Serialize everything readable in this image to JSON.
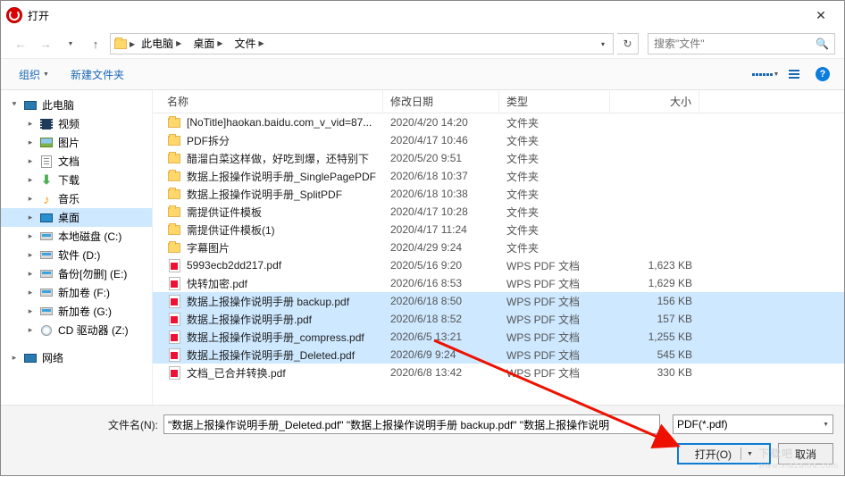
{
  "window": {
    "title": "打开"
  },
  "breadcrumb": {
    "segs": [
      "此电脑",
      "桌面",
      "文件"
    ]
  },
  "search": {
    "placeholder": "搜索\"文件\""
  },
  "toolbar": {
    "organize": "组织",
    "newfolder": "新建文件夹"
  },
  "sidebar": {
    "thispc": "此电脑",
    "items": [
      {
        "label": "视频",
        "icon": "video"
      },
      {
        "label": "图片",
        "icon": "picture"
      },
      {
        "label": "文档",
        "icon": "document"
      },
      {
        "label": "下载",
        "icon": "download"
      },
      {
        "label": "音乐",
        "icon": "music"
      },
      {
        "label": "桌面",
        "icon": "desktop",
        "selected": true
      },
      {
        "label": "本地磁盘 (C:)",
        "icon": "drive"
      },
      {
        "label": "软件 (D:)",
        "icon": "drive"
      },
      {
        "label": "备份[勿删] (E:)",
        "icon": "drive"
      },
      {
        "label": "新加卷 (F:)",
        "icon": "drive"
      },
      {
        "label": "新加卷 (G:)",
        "icon": "drive"
      },
      {
        "label": "CD 驱动器 (Z:)",
        "icon": "cd"
      }
    ],
    "network": "网络"
  },
  "headers": {
    "name": "名称",
    "date": "修改日期",
    "type": "类型",
    "size": "大小"
  },
  "files": [
    {
      "name": "[NoTitle]haokan.baidu.com_v_vid=87...",
      "date": "2020/4/20 14:20",
      "type": "文件夹",
      "size": "",
      "icon": "folder"
    },
    {
      "name": "PDF拆分",
      "date": "2020/4/17 10:46",
      "type": "文件夹",
      "size": "",
      "icon": "folder"
    },
    {
      "name": "醋溜白菜这样做，好吃到爆，还特别下",
      "date": "2020/5/20 9:51",
      "type": "文件夹",
      "size": "",
      "icon": "folder"
    },
    {
      "name": "数据上报操作说明手册_SinglePagePDF",
      "date": "2020/6/18 10:37",
      "type": "文件夹",
      "size": "",
      "icon": "folder"
    },
    {
      "name": "数据上报操作说明手册_SplitPDF",
      "date": "2020/6/18 10:38",
      "type": "文件夹",
      "size": "",
      "icon": "folder"
    },
    {
      "name": "需提供证件模板",
      "date": "2020/4/17 10:28",
      "type": "文件夹",
      "size": "",
      "icon": "folder"
    },
    {
      "name": "需提供证件模板(1)",
      "date": "2020/4/17 11:24",
      "type": "文件夹",
      "size": "",
      "icon": "folder"
    },
    {
      "name": "字幕图片",
      "date": "2020/4/29 9:24",
      "type": "文件夹",
      "size": "",
      "icon": "folder"
    },
    {
      "name": "5993ecb2dd217.pdf",
      "date": "2020/5/16 9:20",
      "type": "WPS PDF 文档",
      "size": "1,623 KB",
      "icon": "pdf"
    },
    {
      "name": "快转加密.pdf",
      "date": "2020/6/16 8:53",
      "type": "WPS PDF 文档",
      "size": "1,629 KB",
      "icon": "pdf"
    },
    {
      "name": "数据上报操作说明手册 backup.pdf",
      "date": "2020/6/18 8:50",
      "type": "WPS PDF 文档",
      "size": "156 KB",
      "icon": "pdf",
      "sel": true
    },
    {
      "name": "数据上报操作说明手册.pdf",
      "date": "2020/6/18 8:52",
      "type": "WPS PDF 文档",
      "size": "157 KB",
      "icon": "pdf",
      "sel": true
    },
    {
      "name": "数据上报操作说明手册_compress.pdf",
      "date": "2020/6/5 13:21",
      "type": "WPS PDF 文档",
      "size": "1,255 KB",
      "icon": "pdf",
      "sel": true
    },
    {
      "name": "数据上报操作说明手册_Deleted.pdf",
      "date": "2020/6/9 9:24",
      "type": "WPS PDF 文档",
      "size": "545 KB",
      "icon": "pdf",
      "sel": true
    },
    {
      "name": "文档_已合并转换.pdf",
      "date": "2020/6/8 13:42",
      "type": "WPS PDF 文档",
      "size": "330 KB",
      "icon": "pdf"
    }
  ],
  "footer": {
    "filename_label": "文件名(N):",
    "filename_value": "\"数据上报操作说明手册_Deleted.pdf\" \"数据上报操作说明手册 backup.pdf\" \"数据上报操作说明",
    "filetype": "PDF(*.pdf)",
    "open": "打开(O)",
    "cancel": "取消"
  },
  "watermark": {
    "main": "下载吧",
    "sub": "www.xiazaiba.com"
  }
}
